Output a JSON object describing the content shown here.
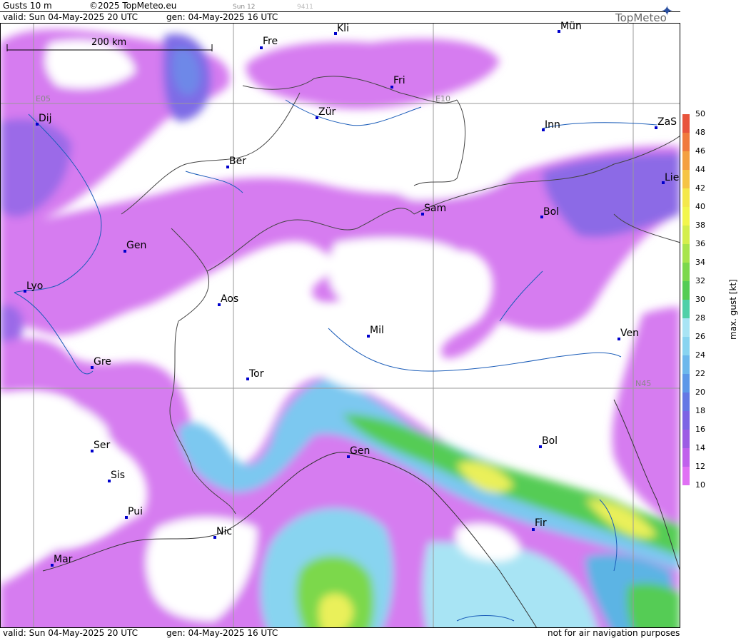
{
  "header": {
    "product": "Gusts 10 m",
    "copyright": "©2025 TopMeteo.eu",
    "run_small": "Sun 12",
    "code_small": "9411",
    "valid": "valid:  Sun  04-May-2025  20 UTC",
    "gen": "gen: 04-May-2025 16 UTC"
  },
  "footer": {
    "valid": "valid:  Sun  04-May-2025  20 UTC",
    "gen": "gen: 04-May-2025 16 UTC",
    "disclaimer": "not for air navigation purposes"
  },
  "logo": {
    "text": "TopMeteo"
  },
  "scale": {
    "label": "200 km"
  },
  "grid_labels": {
    "e05": "E05",
    "e10": "E10",
    "n45": "N45"
  },
  "cities": [
    {
      "name": "Kli"
    },
    {
      "name": "Mün"
    },
    {
      "name": "Fre"
    },
    {
      "name": "Fri"
    },
    {
      "name": "Dij"
    },
    {
      "name": "Zür"
    },
    {
      "name": "Inn"
    },
    {
      "name": "ZaS"
    },
    {
      "name": "Ber"
    },
    {
      "name": "Lie"
    },
    {
      "name": "Sam"
    },
    {
      "name": "Bol"
    },
    {
      "name": "Gen"
    },
    {
      "name": "Lyo"
    },
    {
      "name": "Aos"
    },
    {
      "name": "Ven"
    },
    {
      "name": "Mil"
    },
    {
      "name": "Gre"
    },
    {
      "name": "Tor"
    },
    {
      "name": "Ser"
    },
    {
      "name": "Bol"
    },
    {
      "name": "Gen"
    },
    {
      "name": "Sis"
    },
    {
      "name": "Pui"
    },
    {
      "name": "Fir"
    },
    {
      "name": "Nic"
    },
    {
      "name": "Mar"
    }
  ],
  "legend": {
    "title": "max. gust [kt]",
    "levels": [
      "50",
      "48",
      "46",
      "44",
      "42",
      "40",
      "38",
      "36",
      "34",
      "32",
      "30",
      "28",
      "26",
      "24",
      "22",
      "20",
      "18",
      "16",
      "14",
      "12",
      "10"
    ],
    "colors": [
      "#e8543c",
      "#f07a3c",
      "#f4a040",
      "#f6c444",
      "#f4e84a",
      "#f2f64c",
      "#d4ee4c",
      "#a8e44c",
      "#7cd84c",
      "#54cc54",
      "#50d0a8",
      "#a8e4f4",
      "#88d4f0",
      "#6cb8ec",
      "#5c98e8",
      "#6478e4",
      "#7c64e4",
      "#9c5ce4",
      "#c060ec",
      "#e070f4"
    ]
  }
}
